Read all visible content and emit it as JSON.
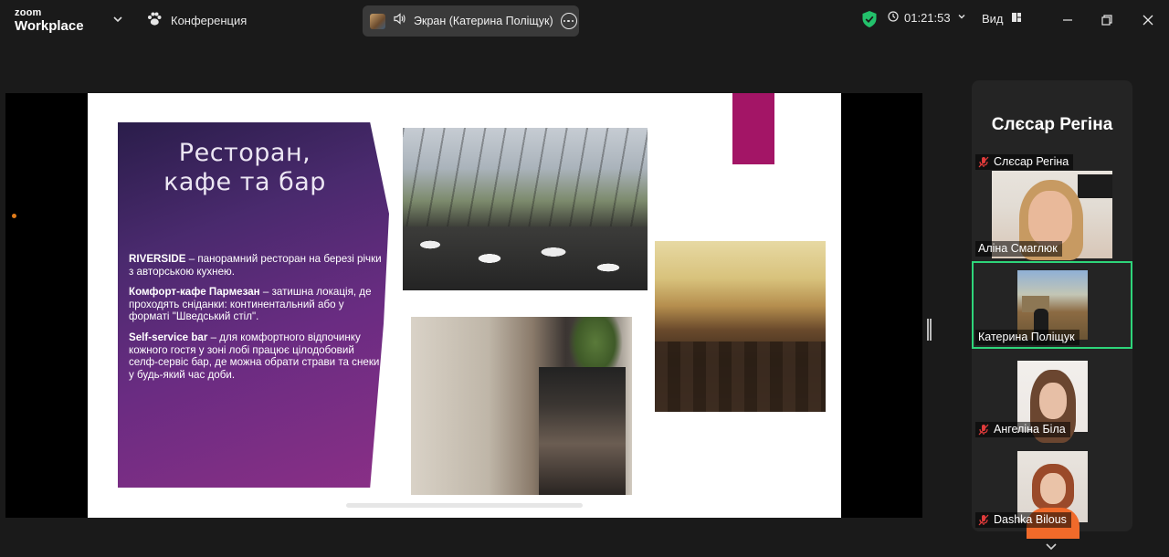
{
  "app": {
    "brand_line1": "zoom",
    "brand_line2": "Workplace",
    "meeting_label": "Конференция",
    "share_label": "Экран (Катерина Поліщук)",
    "timer": "01:21:53",
    "view_label": "Вид"
  },
  "slide": {
    "title": "Ресторан,\nкафе та бар",
    "paragraphs": [
      {
        "bold": "RIVERSIDE",
        "text": " – панорамний ресторан на березі річки з авторською кухнею."
      },
      {
        "bold": "Комфорт-кафе Пармезан",
        "text": " – затишна локація, де проходять сніданки: континентальний або у форматі \"Шведський стіл\"."
      },
      {
        "bold": "Self-service bar",
        "text": " – для комфортного відпочинку кожного гостя у зоні лобі працює цілодобовий селф-сервіс бар, де можна обрати страви та снеки у будь-який час доби."
      }
    ]
  },
  "participants": {
    "active_speaker": "Слєсар Регіна",
    "tiles": [
      {
        "name": "Слєсар Регіна",
        "muted": true
      },
      {
        "name": "Аліна Смаглюк",
        "muted": false
      },
      {
        "name": "Катерина Поліщук",
        "muted": false,
        "active": true
      },
      {
        "name": "Ангеліна Біла",
        "muted": true
      },
      {
        "name": "Dashka Bilous",
        "muted": true
      }
    ]
  },
  "colors": {
    "background": "#1a1a1a",
    "share_pill": "#3a3a3a",
    "active_outline": "#2ed57a",
    "muted_mic": "#e03b3b",
    "shield": "#23c16b",
    "slide_magenta": "#a31566",
    "slide_purple": "#6a2c82"
  },
  "icons": {
    "meeting": "paw-icon",
    "share_audio": "speaker-icon",
    "share_more": "more-horizontal-icon",
    "security": "shield-check-icon",
    "timer": "clock-icon",
    "view": "view-grid-icon",
    "minimize": "minimize-icon",
    "restore": "restore-icon",
    "close": "close-icon",
    "muted": "mic-muted-icon"
  }
}
